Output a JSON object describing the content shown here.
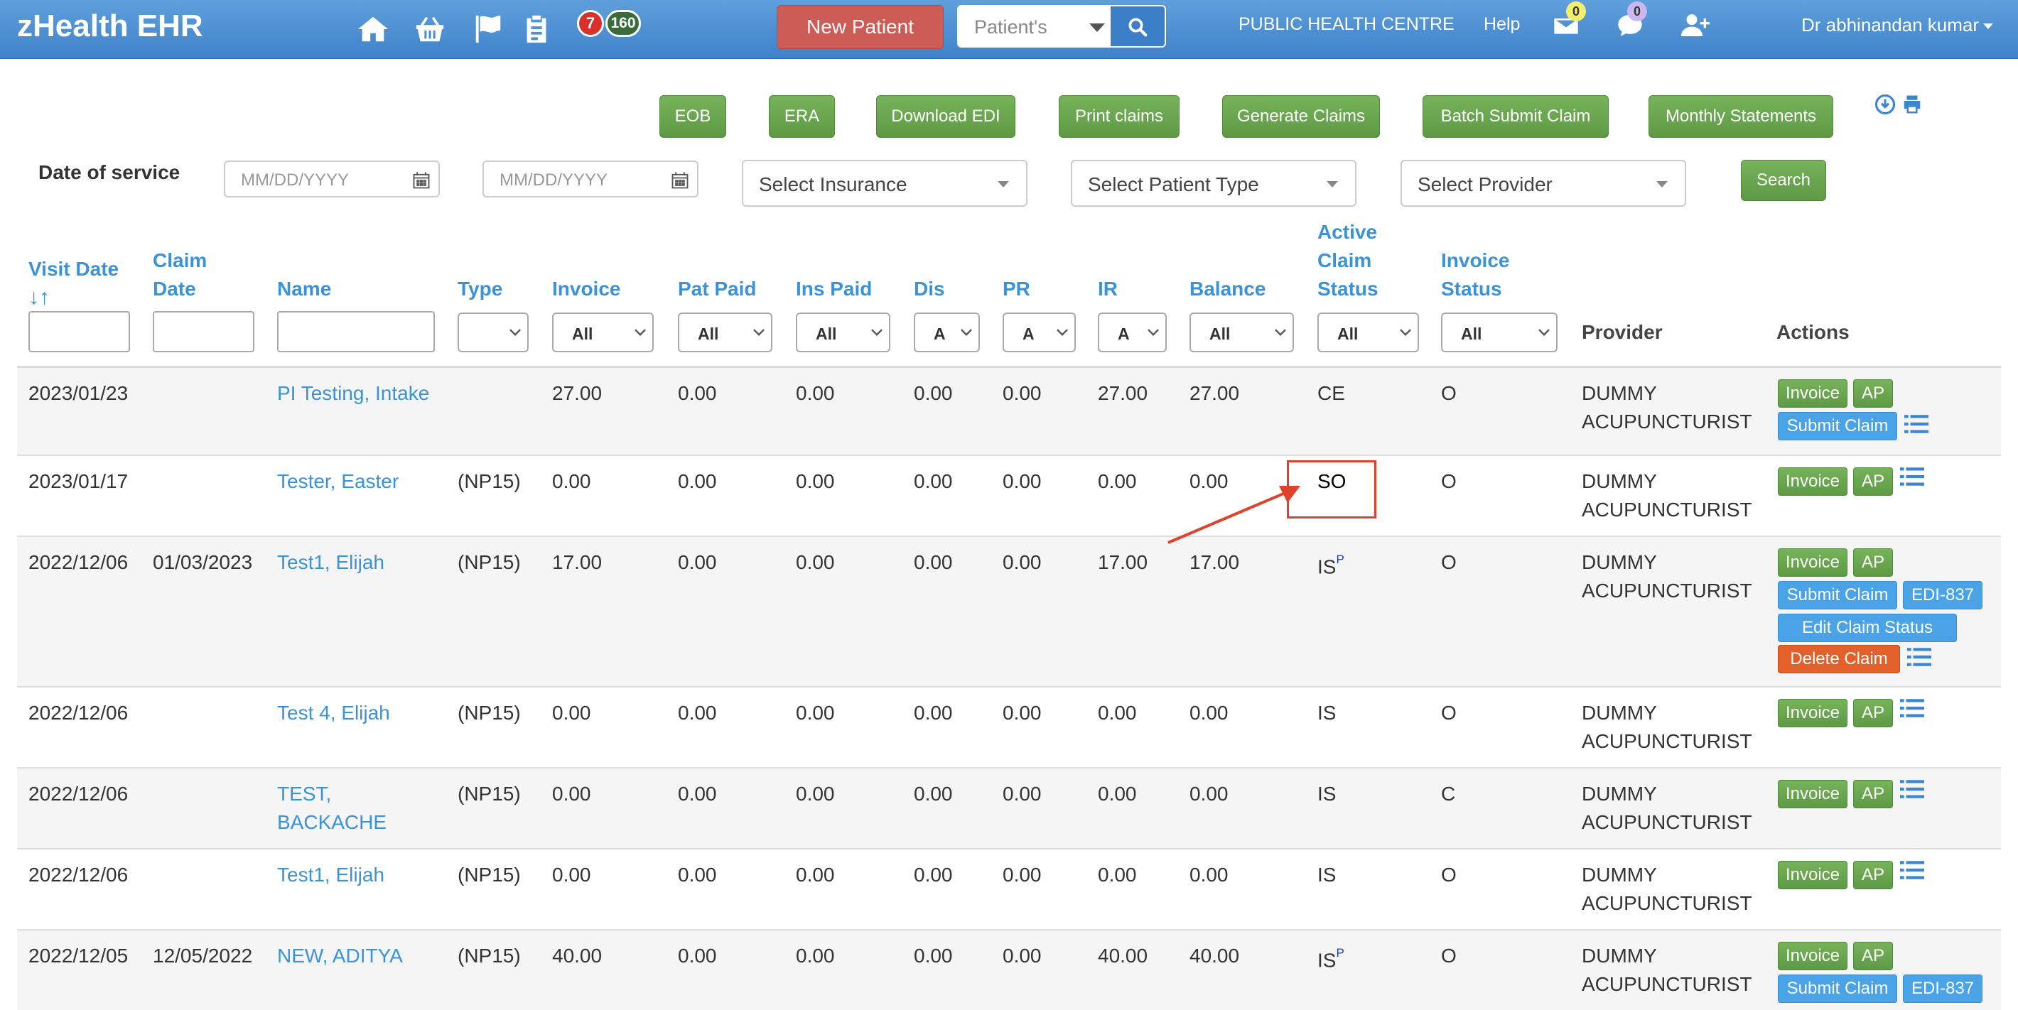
{
  "app": {
    "title": "zHealth EHR"
  },
  "nav": {
    "badge_red": "7",
    "badge_green": "160",
    "new_patient": "New Patient",
    "search_placeholder": "Patient's",
    "centre": "PUBLIC HEALTH CENTRE",
    "help": "Help",
    "mail_count": "0",
    "chat_count": "0",
    "user": "Dr abhinandan kumar"
  },
  "toolbar": {
    "eob": "EOB",
    "era": "ERA",
    "download_edi": "Download EDI",
    "print_claims": "Print claims",
    "generate_claims": "Generate Claims",
    "batch_submit": "Batch Submit Claim",
    "monthly_statements": "Monthly Statements"
  },
  "filters": {
    "date_of_service_label": "Date of service",
    "date_from_placeholder": "MM/DD/YYYY",
    "date_to_placeholder": "MM/DD/YYYY",
    "insurance": "Select Insurance",
    "patient_type": "Select Patient Type",
    "provider": "Select Provider",
    "search": "Search"
  },
  "columns": {
    "visit_date": "Visit Date",
    "claim_date_1": "Claim",
    "claim_date_2": "Date",
    "name": "Name",
    "type": "Type",
    "invoice": "Invoice",
    "pat_paid": "Pat Paid",
    "ins_paid": "Ins Paid",
    "dis": "Dis",
    "pr": "PR",
    "ir": "IR",
    "balance": "Balance",
    "active_1": "Active",
    "active_2": "Claim",
    "active_3": "Status",
    "invoice_status_1": "Invoice",
    "invoice_status_2": "Status",
    "provider": "Provider",
    "actions": "Actions"
  },
  "header_filters": {
    "invoice": "All",
    "pat_paid": "All",
    "ins_paid": "All",
    "dis": "A",
    "pr": "A",
    "ir": "A",
    "balance": "All",
    "active": "All",
    "invoice_status": "All"
  },
  "rows": [
    {
      "visit_date": "2023/01/23",
      "claim_date": "",
      "name": "PI Testing, Intake",
      "name2": "",
      "type": "",
      "invoice": "27.00",
      "pat_paid": "0.00",
      "ins_paid": "0.00",
      "dis": "0.00",
      "pr": "0.00",
      "ir": "27.00",
      "balance": "27.00",
      "active": "CE",
      "active_sup": "",
      "inv_status": "O",
      "provider1": "DUMMY",
      "provider2": "ACUPUNCTURIST"
    },
    {
      "visit_date": "2023/01/17",
      "claim_date": "",
      "name": "Tester, Easter",
      "name2": "",
      "type": "(NP15)",
      "invoice": "0.00",
      "pat_paid": "0.00",
      "ins_paid": "0.00",
      "dis": "0.00",
      "pr": "0.00",
      "ir": "0.00",
      "balance": "0.00",
      "active": "SO",
      "active_sup": "",
      "inv_status": "O",
      "provider1": "DUMMY",
      "provider2": "ACUPUNCTURIST"
    },
    {
      "visit_date": "2022/12/06",
      "claim_date": "01/03/2023",
      "name": "Test1, Elijah",
      "name2": "",
      "type": "(NP15)",
      "invoice": "17.00",
      "pat_paid": "0.00",
      "ins_paid": "0.00",
      "dis": "0.00",
      "pr": "0.00",
      "ir": "17.00",
      "balance": "17.00",
      "active": "IS",
      "active_sup": "P",
      "inv_status": "O",
      "provider1": "DUMMY",
      "provider2": "ACUPUNCTURIST"
    },
    {
      "visit_date": "2022/12/06",
      "claim_date": "",
      "name": "Test 4, Elijah",
      "name2": "",
      "type": "(NP15)",
      "invoice": "0.00",
      "pat_paid": "0.00",
      "ins_paid": "0.00",
      "dis": "0.00",
      "pr": "0.00",
      "ir": "0.00",
      "balance": "0.00",
      "active": "IS",
      "active_sup": "",
      "inv_status": "O",
      "provider1": "DUMMY",
      "provider2": "ACUPUNCTURIST"
    },
    {
      "visit_date": "2022/12/06",
      "claim_date": "",
      "name": "TEST,",
      "name2": "BACKACHE",
      "type": "(NP15)",
      "invoice": "0.00",
      "pat_paid": "0.00",
      "ins_paid": "0.00",
      "dis": "0.00",
      "pr": "0.00",
      "ir": "0.00",
      "balance": "0.00",
      "active": "IS",
      "active_sup": "",
      "inv_status": "C",
      "provider1": "DUMMY",
      "provider2": "ACUPUNCTURIST"
    },
    {
      "visit_date": "2022/12/06",
      "claim_date": "",
      "name": "Test1, Elijah",
      "name2": "",
      "type": "(NP15)",
      "invoice": "0.00",
      "pat_paid": "0.00",
      "ins_paid": "0.00",
      "dis": "0.00",
      "pr": "0.00",
      "ir": "0.00",
      "balance": "0.00",
      "active": "IS",
      "active_sup": "",
      "inv_status": "O",
      "provider1": "DUMMY",
      "provider2": "ACUPUNCTURIST"
    },
    {
      "visit_date": "2022/12/05",
      "claim_date": "12/05/2022",
      "name": "NEW, ADITYA",
      "name2": "",
      "type": "(NP15)",
      "invoice": "40.00",
      "pat_paid": "0.00",
      "ins_paid": "0.00",
      "dis": "0.00",
      "pr": "0.00",
      "ir": "40.00",
      "balance": "40.00",
      "active": "IS",
      "active_sup": "P",
      "inv_status": "O",
      "provider1": "DUMMY",
      "provider2": "ACUPUNCTURIST"
    }
  ],
  "actions": {
    "invoice": "Invoice",
    "ap": "AP",
    "submit_claim": "Submit Claim",
    "edi837": "EDI-837",
    "edit_claim_status": "Edit Claim Status",
    "delete_claim": "Delete Claim"
  }
}
